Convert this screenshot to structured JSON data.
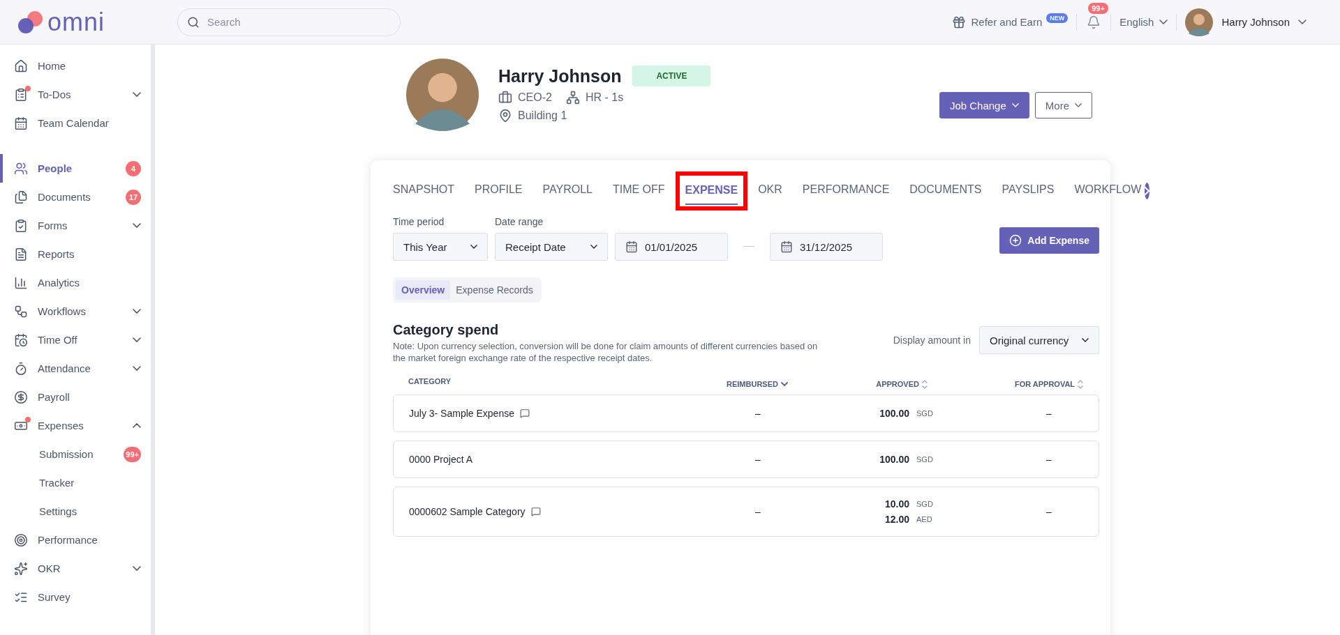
{
  "header": {
    "logo": "omni",
    "search": {
      "placeholder": "Search"
    },
    "refer": {
      "label": "Refer and Earn",
      "badge": "NEW"
    },
    "notifications": {
      "badge": "99+"
    },
    "language": "English",
    "user": {
      "name": "Harry Johnson"
    }
  },
  "sidebar": {
    "groups": [
      [
        {
          "label": "Home",
          "selected": false
        },
        {
          "label": "To-Dos",
          "selected": false,
          "dot": true,
          "expanded": false
        },
        {
          "label": "Team Calendar",
          "selected": false
        }
      ],
      [
        {
          "label": "People",
          "selected": true,
          "badge": "4"
        },
        {
          "label": "Documents",
          "selected": false,
          "badge": "17"
        },
        {
          "label": "Forms",
          "selected": false,
          "expanded": false
        },
        {
          "label": "Reports",
          "selected": false
        },
        {
          "label": "Analytics",
          "selected": false
        },
        {
          "label": "Workflows",
          "selected": false,
          "expanded": false
        },
        {
          "label": "Time Off",
          "selected": false,
          "expanded": false
        },
        {
          "label": "Attendance",
          "selected": false,
          "expanded": false
        },
        {
          "label": "Payroll",
          "selected": false
        },
        {
          "label": "Expenses",
          "selected": false,
          "dot": true,
          "expanded": true,
          "children": [
            {
              "label": "Submission",
              "selected": false,
              "badge": "99+"
            },
            {
              "label": "Tracker",
              "selected": false
            },
            {
              "label": "Settings",
              "selected": false
            }
          ]
        },
        {
          "label": "Performance",
          "selected": false
        },
        {
          "label": "OKR",
          "selected": false,
          "expanded": false
        },
        {
          "label": "Survey",
          "selected": false
        }
      ]
    ]
  },
  "profile": {
    "name": "Harry Johnson",
    "status": "ACTIVE",
    "position": "CEO-2",
    "department": "HR - 1s",
    "location": "Building 1",
    "buttons": [
      {
        "label": "Job Change",
        "primary": true
      },
      {
        "label": "More",
        "primary": false
      }
    ]
  },
  "tabs": [
    {
      "label": "SNAPSHOT",
      "selected": false,
      "annotated": false
    },
    {
      "label": "PROFILE",
      "selected": false,
      "annotated": false
    },
    {
      "label": "PAYROLL",
      "selected": false,
      "annotated": false
    },
    {
      "label": "TIME OFF",
      "selected": false,
      "annotated": false
    },
    {
      "label": "EXPENSE",
      "selected": true,
      "annotated": true
    },
    {
      "label": "OKR",
      "selected": false,
      "annotated": false
    },
    {
      "label": "PERFORMANCE",
      "selected": false,
      "annotated": false
    },
    {
      "label": "DOCUMENTS",
      "selected": false,
      "annotated": false
    },
    {
      "label": "PAYSLIPS",
      "selected": false,
      "annotated": false
    },
    {
      "label": "WORKFLOW",
      "selected": false,
      "annotated": false
    }
  ],
  "filters": {
    "time_period": {
      "label": "Time period",
      "value": "This Year"
    },
    "date_range": {
      "label": "Date range",
      "value": "Receipt Date",
      "from": "01/01/2025",
      "to": "31/12/2025"
    },
    "add_button": "Add Expense"
  },
  "views": [
    {
      "label": "Overview",
      "selected": true
    },
    {
      "label": "Expense Records",
      "selected": false
    }
  ],
  "category_spend": {
    "title": "Category spend",
    "note": "Note: Upon currency selection, conversion will be done for claim amounts of different currencies based on the market foreign exchange rate of the respective receipt dates.",
    "display_label": "Display amount in",
    "display_value": "Original currency",
    "columns": [
      {
        "label": "CATEGORY",
        "sortable": false
      },
      {
        "label": "REIMBURSED",
        "sorted": true,
        "sortable": true
      },
      {
        "label": "APPROVED",
        "sorted": false,
        "sortable": true
      },
      {
        "label": "FOR APPROVAL",
        "sorted": false,
        "sortable": true
      }
    ],
    "rows": [
      {
        "category": "July 3- Sample Expense",
        "has_note": true,
        "reimbursed": "–",
        "approved": [
          {
            "amount": "100.00",
            "currency": "SGD"
          }
        ],
        "for_approval": "–"
      },
      {
        "category": "0000 Project A",
        "has_note": false,
        "reimbursed": "–",
        "approved": [
          {
            "amount": "100.00",
            "currency": "SGD"
          }
        ],
        "for_approval": "–"
      },
      {
        "category": "0000602 Sample Category",
        "has_note": true,
        "reimbursed": "–",
        "approved": [
          {
            "amount": "10.00",
            "currency": "SGD"
          },
          {
            "amount": "12.00",
            "currency": "AED"
          }
        ],
        "for_approval": "–"
      }
    ]
  }
}
